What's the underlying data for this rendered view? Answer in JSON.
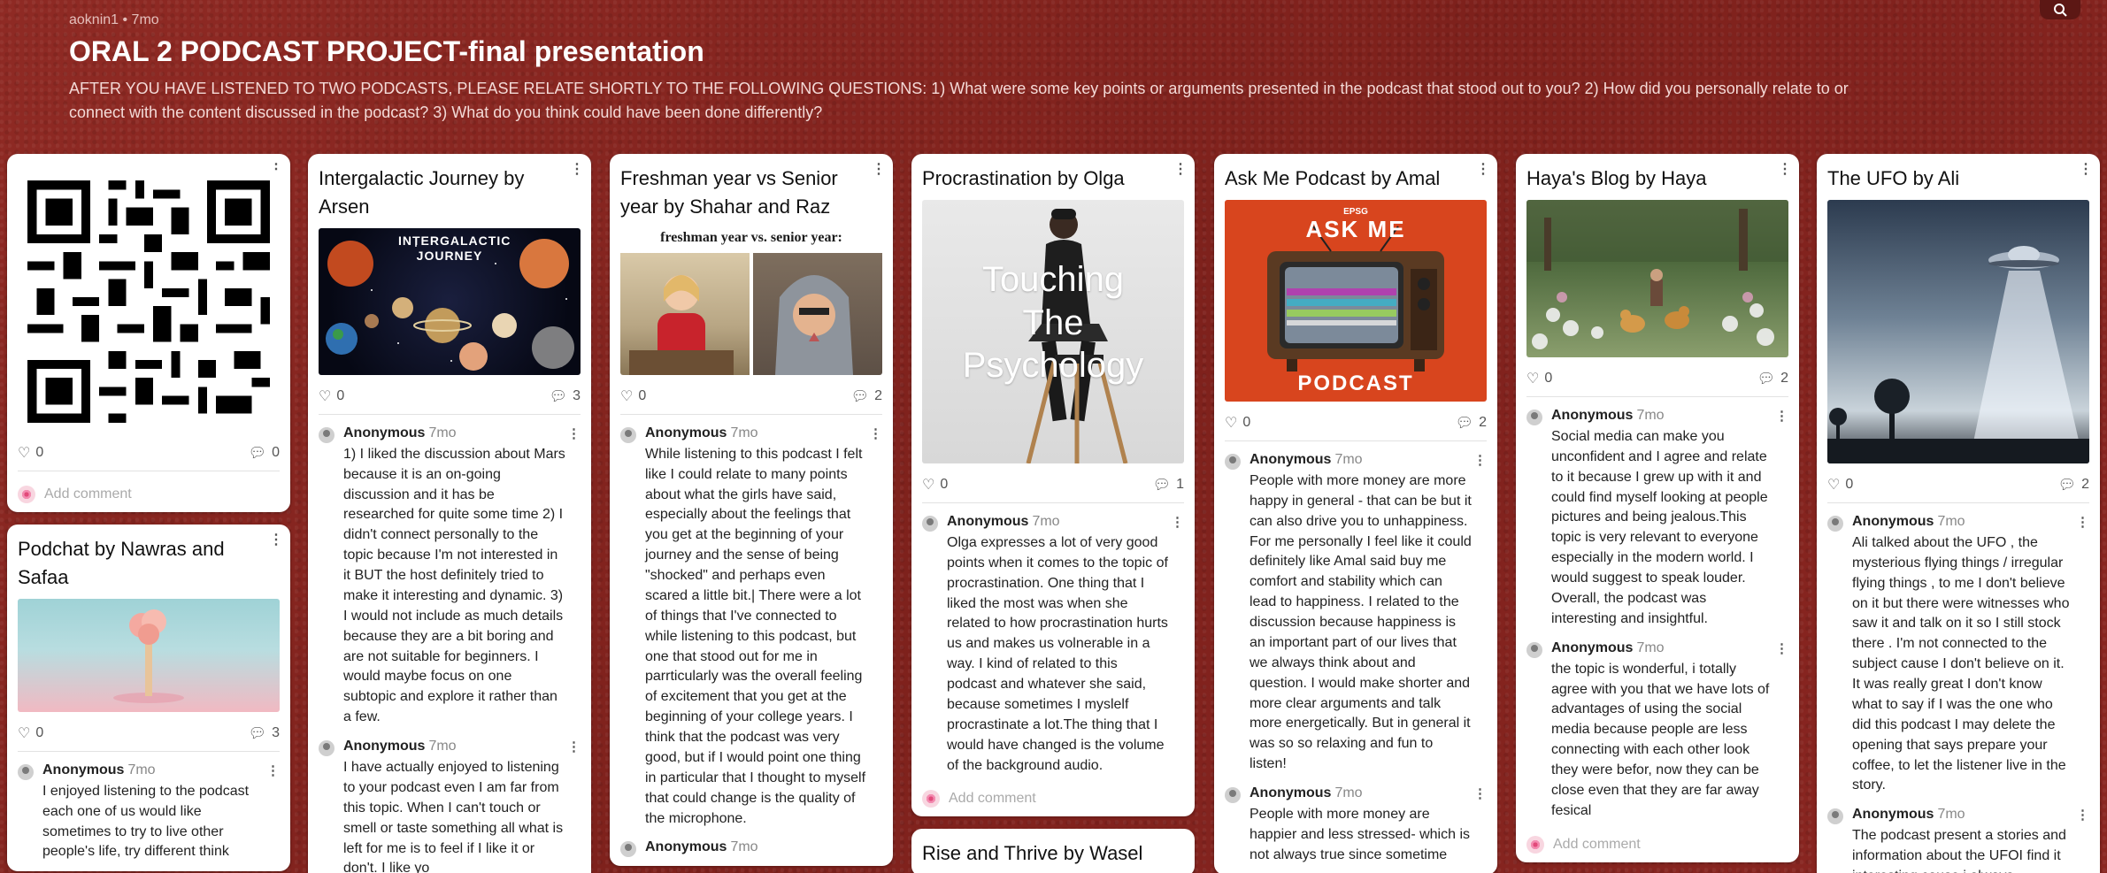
{
  "header": {
    "author": "aoknin1",
    "time": "7mo",
    "title": "ORAL 2 PODCAST PROJECT-final presentation",
    "description": "AFTER YOU HAVE LISTENED TO TWO PODCASTS,  PLEASE RELATE  SHORTLY TO THE FOLLOWING QUESTIONS: 1) What were some key points or arguments presented in the podcast that stood out to you? 2) How did you personally relate to or connect with the content discussed in the podcast? 3)  What do you think could have been done differently?"
  },
  "common": {
    "anon": "Anonymous",
    "ago": "7mo",
    "add_comment": "Add comment"
  },
  "cards": {
    "qr": {
      "likes": "0",
      "comments": "0"
    },
    "podchat": {
      "title": "Podchat by Nawras and Safaa",
      "likes": "0",
      "comments": "3",
      "c1": "I enjoyed listening to the podcast each one of us would like sometimes to try to live other people's life, try different think"
    },
    "intergalactic": {
      "title": "Intergalactic Journey by Arsen",
      "image_text": "INTERGALACTIC JOURNEY",
      "likes": "0",
      "comments": "3",
      "c1": "1) I liked the discussion about Mars because it is an on-going discussion and it has be researched for quite some time 2) I didn't connect personally to the topic because I'm not interested in it BUT the host definitely tried to make it interesting and dynamic. 3) I would not include as much details because they are a bit boring and are not suitable for beginners. I would maybe focus on one subtopic and explore it rather than a few.",
      "c2": "I have actually enjoyed to listening to your podcast even I am far from this topic. When I can't touch or smell or taste something all what is left for me is to feel if I like it or don't. I like yo"
    },
    "freshman": {
      "title": "Freshman year vs Senior year by Shahar and Raz",
      "image_caption": "freshman year vs. senior year:",
      "likes": "0",
      "comments": "2",
      "c1": "While listening to this podcast I felt like I could relate to many points about what the girls have said, especially about the feelings that you get at the beginning of your journey and the sense of being \"shocked\" and perhaps even scared a little bit.| There were a lot of things that I've connected to while listening to this podcast, but one that stood out for me in parrticularly was the overall  feeling of excitement that you get at the beginning of your college years. I think that the podcast was very good, but if I would point one thing in particular that I thought to myself that could change is the quality of the microphone."
    },
    "procrastination": {
      "title": "Procrastination by Olga",
      "image_text_1": "Touching",
      "image_text_2": "The",
      "image_text_3": "Psychology",
      "likes": "0",
      "comments": "1",
      "c1": "Olga expresses a lot of very good points when it comes to  the topic of procrastination. One thing that I liked the most was when she related to how procrastination hurts us and makes us volnerable in a way. I kind of related to this podcast and whatever she said, because sometimes I myslelf procrastinate a lot.The thing that I would have changed is the volume of the background audio."
    },
    "rise": {
      "title": "Rise and Thrive by Wasel"
    },
    "askme": {
      "title": "Ask Me Podcast by Amal",
      "img_top": "EPSG",
      "img_title": "ASK ME",
      "img_bottom": "PODCAST",
      "likes": "0",
      "comments": "2",
      "c1": "People with more money are more happy in general - that can be but it can also drive you to unhappiness. For me personally I feel like it could definitely like Amal said buy me comfort and stability which can lead to happiness. I related to the discussion because happiness is an important part of our lives that we always think about and question. I would make shorter and more clear arguments and talk more energetically. But in general it was so so relaxing and fun to listen!",
      "c2": "People with more money are happier and less stressed- which is not always true since sometime"
    },
    "haya": {
      "title": "Haya's Blog by Haya",
      "likes": "0",
      "comments": "2",
      "c1": "Social media can make you unconfident and I agree and relate to it because I grew up with it and could find myself looking at people pictures and being jealous.This topic is very relevant to everyone especially in the modern world. I would suggest to speak louder. Overall, the podcast was interesting and insightful.",
      "c2": "the topic is wonderful, i totally agree with you that we have lots of advantages of using the social media because people are less connecting with each other look they were befor, now they can be close even that they are far away fesical"
    },
    "ufo": {
      "title": "The UFO by Ali",
      "likes": "0",
      "comments": "2",
      "c1": "Ali talked about the UFO , the mysterious flying things / irregular flying things , to me I don't believe on it but there were witnesses who saw it and talk on it so I still stock there . I'm not connected to the subject cause I don't believe on it. It was really great I don't know what to say if I was the one who did this podcast I may delete the opening that says prepare your coffee, to let the listener live in the story.",
      "c2": "The podcast present a stories and information about the UFOI find it interesting cause i always"
    }
  }
}
